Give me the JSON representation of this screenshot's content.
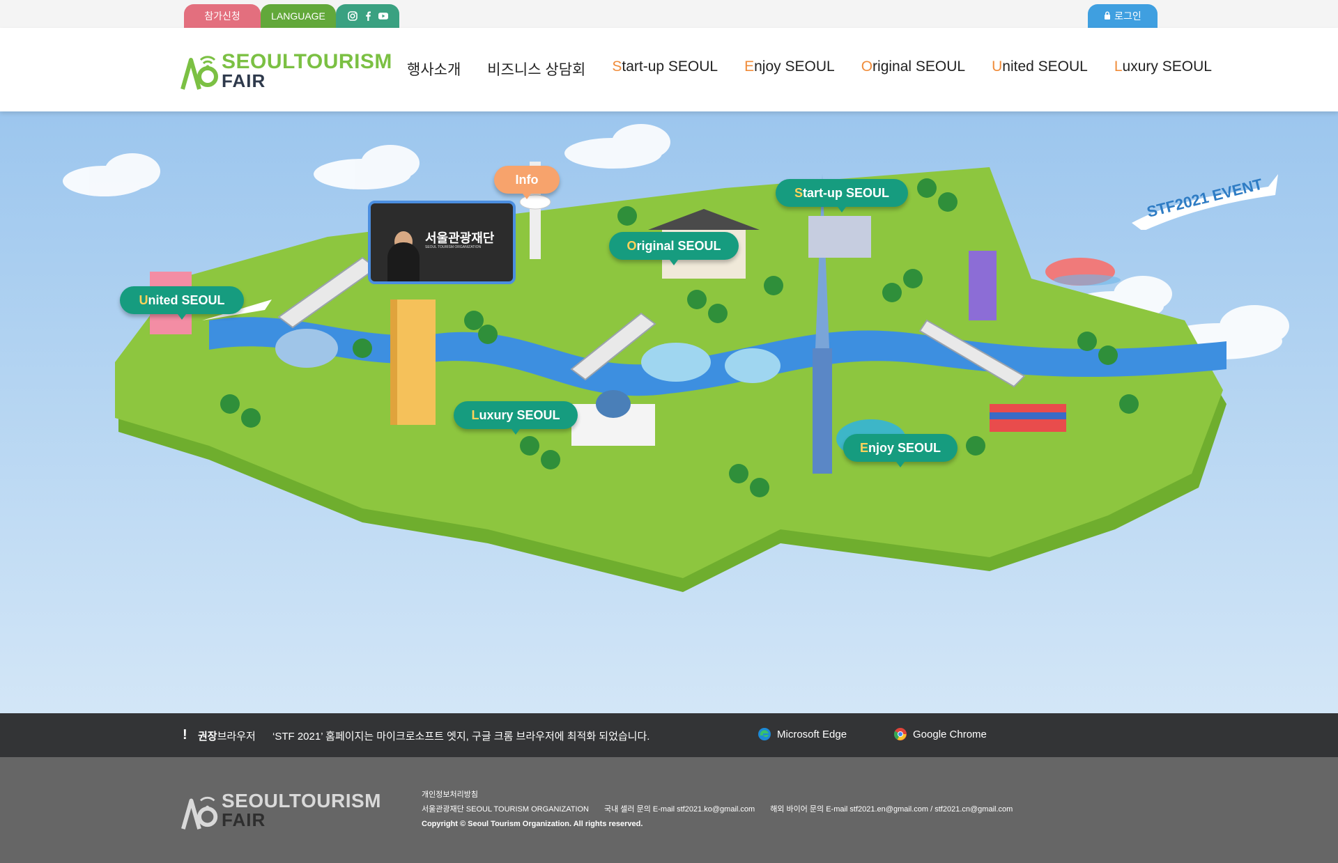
{
  "topbar": {
    "join_label": "참가신청",
    "language_label": "LANGUAGE",
    "sns": [
      "instagram-icon",
      "facebook-icon",
      "youtube-icon"
    ],
    "login_label": "로그인"
  },
  "header": {
    "logo_line1": "SEOULTOURISM",
    "logo_line2": "FAIR",
    "nav": [
      {
        "first": "",
        "rest": "행사소개"
      },
      {
        "first": "",
        "rest": "비즈니스 상담회"
      },
      {
        "first": "S",
        "rest": "tart-up SEOUL"
      },
      {
        "first": "E",
        "rest": "njoy SEOUL"
      },
      {
        "first": "O",
        "rest": "riginal SEOUL"
      },
      {
        "first": "U",
        "rest": "nited SEOUL"
      },
      {
        "first": "L",
        "rest": "uxury SEOUL"
      }
    ]
  },
  "map": {
    "info_label": "Info",
    "video_title": "서울관광재단",
    "video_subtitle": "SEOUL TOURISM ORGANIZATION",
    "event_label": "STF2021 EVENT",
    "zones": [
      {
        "first": "U",
        "rest": "nited SEOUL"
      },
      {
        "first": "O",
        "rest": "riginal SEOUL"
      },
      {
        "first": "S",
        "rest": "tart-up SEOUL"
      },
      {
        "first": "L",
        "rest": "uxury SEOUL"
      },
      {
        "first": "E",
        "rest": "njoy SEOUL"
      }
    ]
  },
  "notice": {
    "mark": "!",
    "label_bold": "권장",
    "label_rest": "브라우저",
    "text": "‘STF 2021’ 홈페이지는 마이크로소프트 엣지, 구글 크롬 브라우저에 최적화 되었습니다.",
    "edge_label": "Microsoft Edge",
    "chrome_label": "Google Chrome"
  },
  "footer": {
    "logo_line1": "SEOULTOURISM",
    "logo_line2": "FAIR",
    "privacy": "개인정보처리방침",
    "org": "서울관광재단 SEOUL TOURISM ORGANIZATION",
    "domestic": "국내 셀러 문의 E-mail stf2021.ko@gmail.com",
    "overseas": "해외 바이어 문의 E-mail stf2021.en@gmail.com / stf2021.cn@gmail.com",
    "copyright": "Copyright © Seoul Tourism Organization. All rights reserved."
  },
  "colors": {
    "join": "#e36f7e",
    "language": "#62a83a",
    "sns": "#3aa181",
    "login": "#3f9fe0",
    "zone_bubble": "#169c7f",
    "info_bubble": "#f7a36c",
    "nav_highlight": "#f08c3a"
  }
}
